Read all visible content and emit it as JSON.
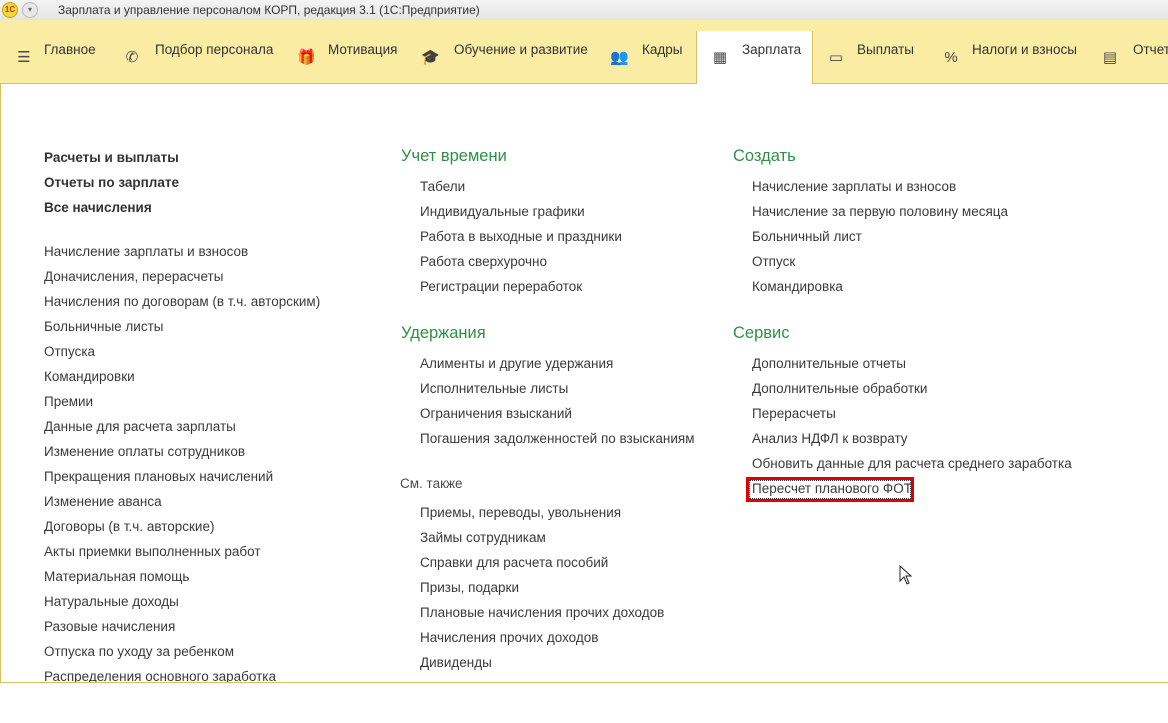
{
  "window": {
    "title": "Зарплата и управление персоналом КОРП, редакция 3.1  (1С:Предприятие)",
    "logo": "1С"
  },
  "sections": [
    {
      "label": "Главное",
      "icon": "hamburger-icon"
    },
    {
      "label": "Подбор персонала",
      "icon": "phone-icon"
    },
    {
      "label": "Мотивация",
      "icon": "gift-icon"
    },
    {
      "label": "Обучение и развитие",
      "icon": "graduation-cap-icon"
    },
    {
      "label": "Кадры",
      "icon": "people-icon"
    },
    {
      "label": "Зарплата",
      "icon": "calculator-icon",
      "active": true
    },
    {
      "label": "Выплаты",
      "icon": "card-icon"
    },
    {
      "label": "Налоги и взносы",
      "icon": "percent-icon"
    },
    {
      "label": "Отчет",
      "icon": "report-icon"
    }
  ],
  "left_column": {
    "main_links": [
      "Расчеты и выплаты",
      "Отчеты по зарплате",
      "Все начисления"
    ],
    "links": [
      "Начисление зарплаты и взносов",
      "Доначисления, перерасчеты",
      "Начисления по договорам (в т.ч. авторским)",
      "Больничные листы",
      "Отпуска",
      "Командировки",
      "Премии",
      "Данные для расчета зарплаты",
      "Изменение оплаты сотрудников",
      "Прекращения плановых начислений",
      "Изменение аванса",
      "Договоры (в т.ч. авторские)",
      "Акты приемки выполненных работ",
      "Материальная помощь",
      "Натуральные доходы",
      "Разовые начисления",
      "Отпуска по уходу за ребенком",
      "Распределения основного заработка"
    ]
  },
  "middle_column": {
    "time_title": "Учет времени",
    "time_links": [
      "Табели",
      "Индивидуальные графики",
      "Работа в выходные и праздники",
      "Работа сверхурочно",
      "Регистрации переработок"
    ],
    "deductions_title": "Удержания",
    "deductions_links": [
      "Алименты и другие удержания",
      "Исполнительные листы",
      "Ограничения взысканий",
      "Погашения задолженностей по взысканиям"
    ],
    "see_also_title": "См. также",
    "see_also_links": [
      "Приемы, переводы, увольнения",
      "Займы сотрудникам",
      "Справки для расчета пособий",
      "Призы, подарки",
      "Плановые начисления прочих доходов",
      "Начисления прочих доходов",
      "Дивиденды"
    ]
  },
  "right_column": {
    "create_title": "Создать",
    "create_links": [
      "Начисление зарплаты и взносов",
      "Начисление за первую половину месяца",
      "Больничный лист",
      "Отпуск",
      "Командировка"
    ],
    "service_title": "Сервис",
    "service_links": [
      "Дополнительные отчеты",
      "Дополнительные обработки",
      "Перерасчеты",
      "Анализ НДФЛ к возврату",
      "Обновить данные для расчета среднего заработка",
      "Пересчет планового ФОТ"
    ]
  },
  "colors": {
    "section_bar": "#fbeca4",
    "group_title": "#2f8f46",
    "highlight": "#e00000"
  }
}
